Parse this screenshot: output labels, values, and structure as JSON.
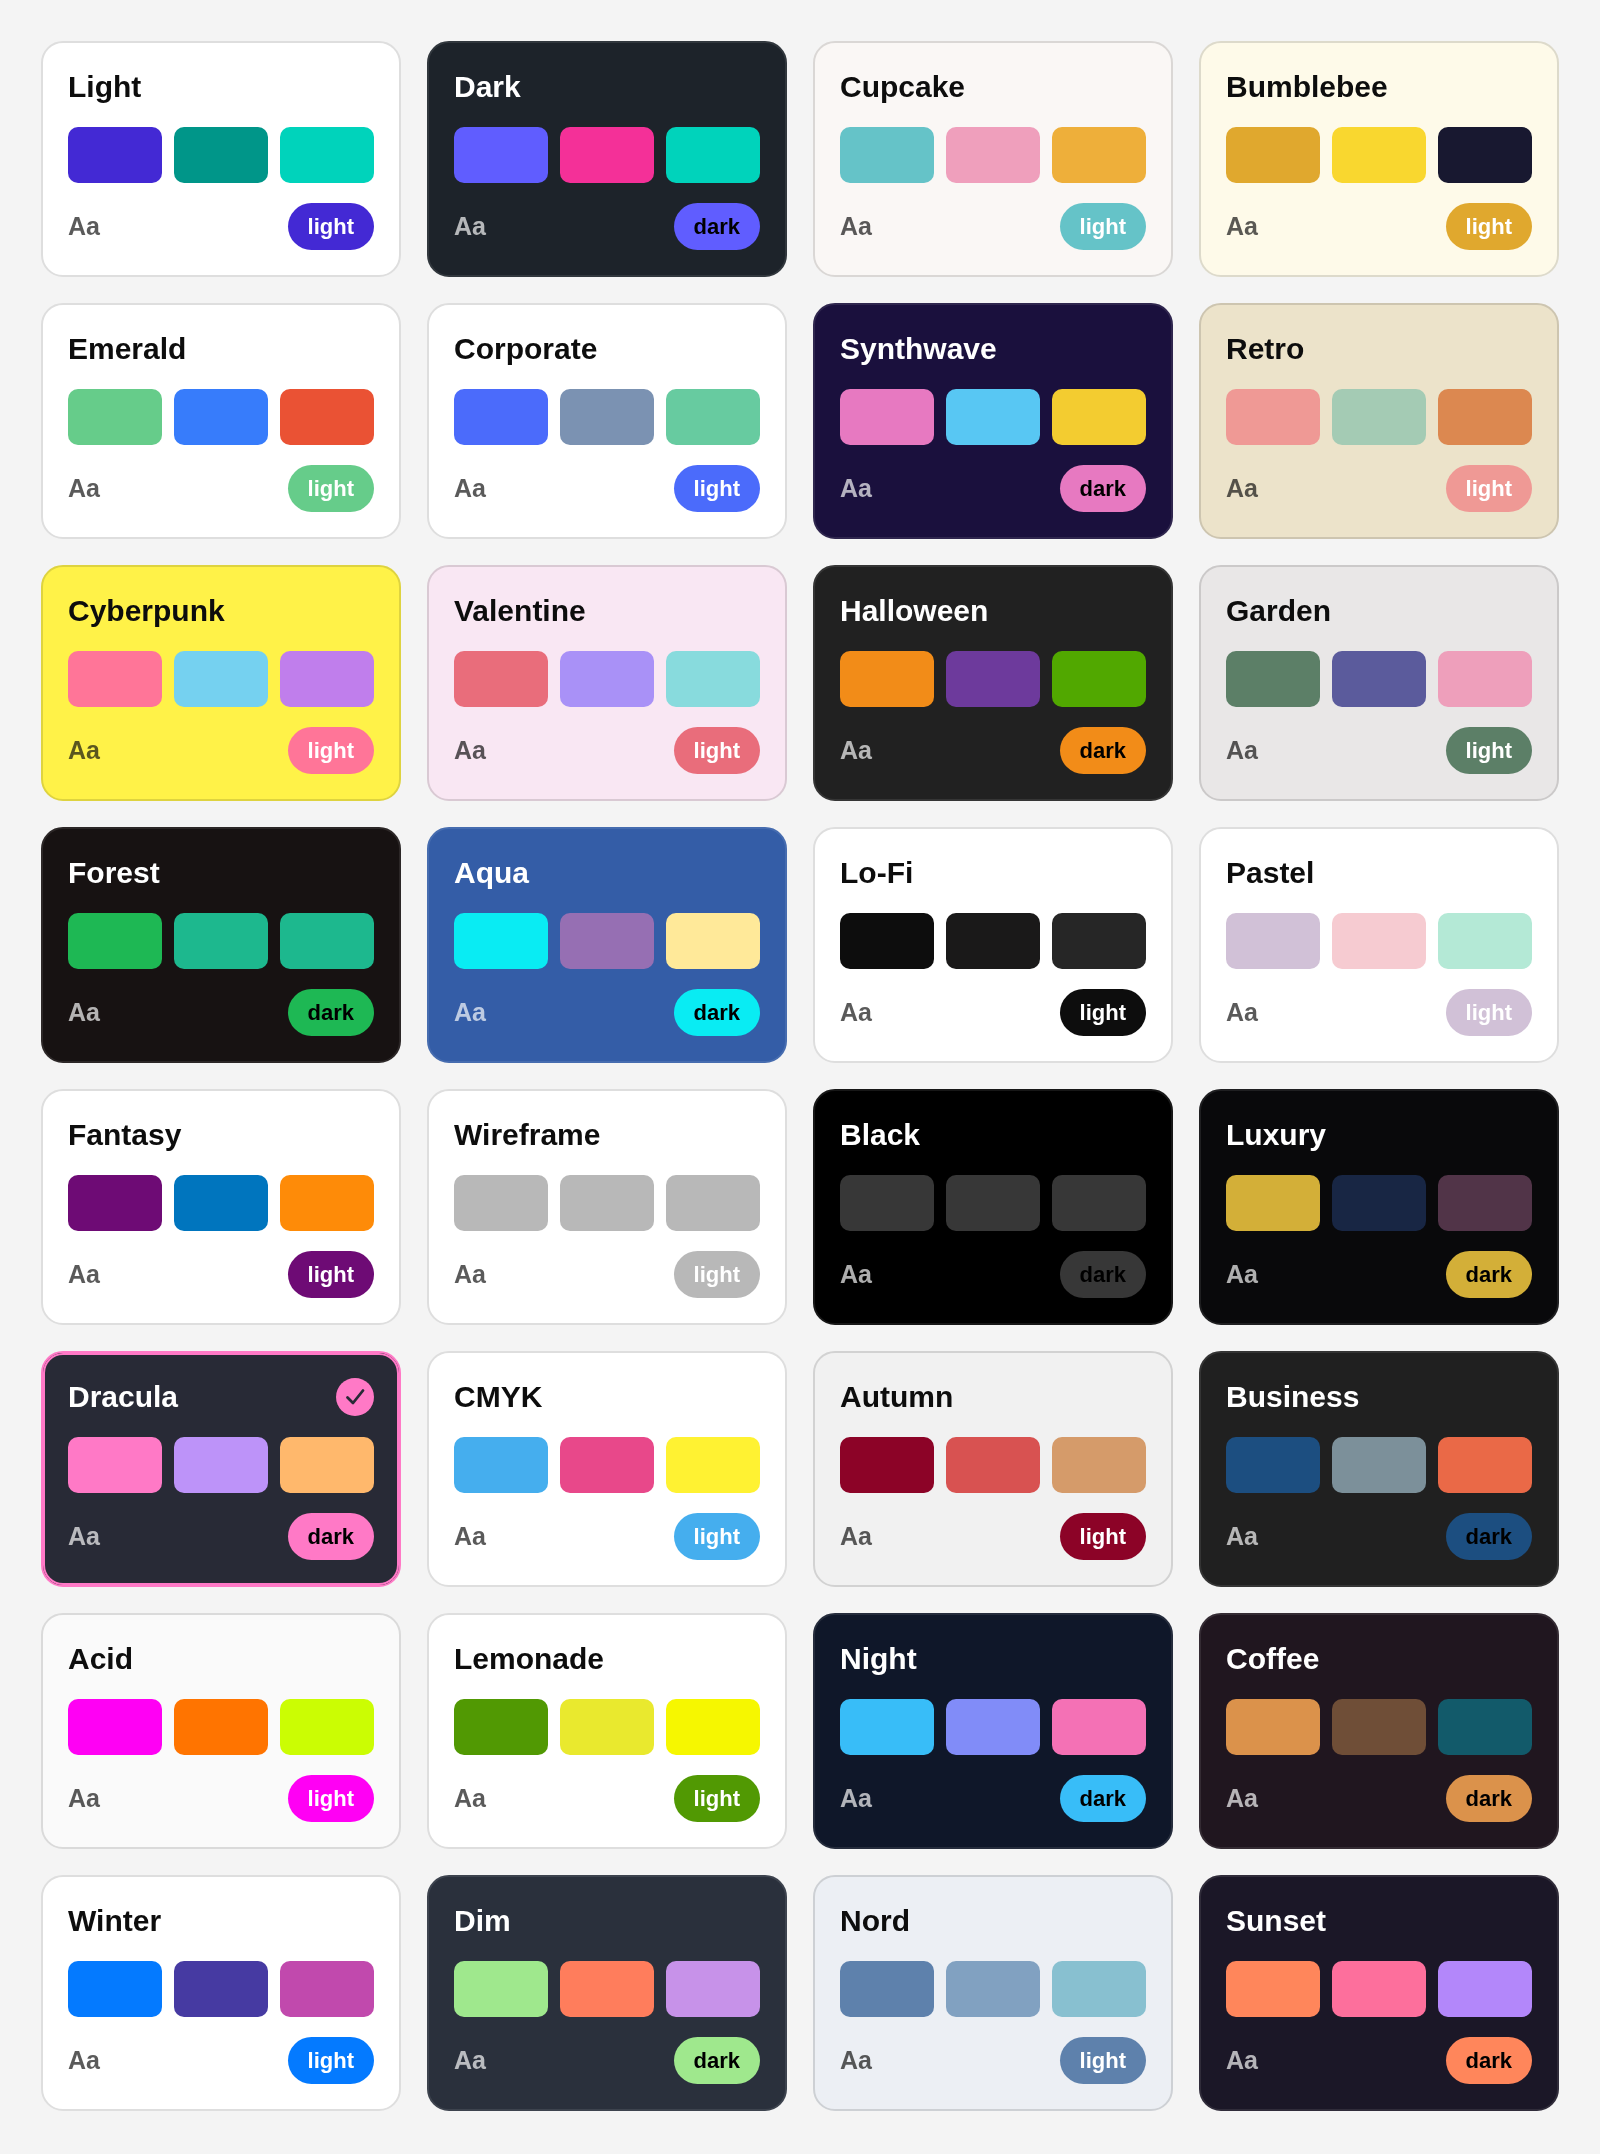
{
  "themes": [
    {
      "name": "Light",
      "kind": "light",
      "color": "#ffffff",
      "selected": false,
      "swatches": [
        {
          "color": "#4329d4"
        },
        {
          "color": "#009689"
        },
        {
          "color": "#00d3bb"
        }
      ],
      "sample": "Aa",
      "mode": "light"
    },
    {
      "name": "Dark",
      "kind": "dark",
      "color": "#1d232a",
      "selected": false,
      "swatches": [
        {
          "color": "#605dff"
        },
        {
          "color": "#f43098"
        },
        {
          "color": "#00d3bb"
        }
      ],
      "sample": "Aa",
      "mode": "dark"
    },
    {
      "name": "Cupcake",
      "kind": "light",
      "color": "#faf7f5",
      "selected": false,
      "swatches": [
        {
          "color": "#65c3c8"
        },
        {
          "color": "#ef9fbc"
        },
        {
          "color": "#eeaf3a"
        }
      ],
      "sample": "Aa",
      "mode": "light"
    },
    {
      "name": "Bumblebee",
      "kind": "light",
      "color": "#fefae9",
      "selected": false,
      "swatches": [
        {
          "color": "#e0a82e"
        },
        {
          "color": "#f9d72f"
        },
        {
          "color": "#181830"
        }
      ],
      "sample": "Aa",
      "mode": "light"
    },
    {
      "name": "Emerald",
      "kind": "light",
      "color": "#ffffff",
      "selected": false,
      "swatches": [
        {
          "color": "#66cc8a"
        },
        {
          "color": "#377cfb"
        },
        {
          "color": "#ea5234"
        }
      ],
      "sample": "Aa",
      "mode": "light"
    },
    {
      "name": "Corporate",
      "kind": "light",
      "color": "#ffffff",
      "selected": false,
      "swatches": [
        {
          "color": "#4b6bfb"
        },
        {
          "color": "#7b92b2"
        },
        {
          "color": "#67cba0"
        }
      ],
      "sample": "Aa",
      "mode": "light"
    },
    {
      "name": "Synthwave",
      "kind": "dark",
      "color": "#1a103d",
      "selected": false,
      "swatches": [
        {
          "color": "#e779c1"
        },
        {
          "color": "#58c7f3"
        },
        {
          "color": "#f3cc30"
        }
      ],
      "sample": "Aa",
      "mode": "dark"
    },
    {
      "name": "Retro",
      "kind": "light",
      "color": "#ece3ca",
      "selected": false,
      "swatches": [
        {
          "color": "#ef9995"
        },
        {
          "color": "#a4cbb4"
        },
        {
          "color": "#dc8850"
        }
      ],
      "sample": "Aa",
      "mode": "light"
    },
    {
      "name": "Cyberpunk",
      "kind": "light",
      "color": "#fff248",
      "selected": false,
      "swatches": [
        {
          "color": "#ff7598"
        },
        {
          "color": "#75d1f0"
        },
        {
          "color": "#c07eec"
        }
      ],
      "sample": "Aa",
      "mode": "light"
    },
    {
      "name": "Valentine",
      "kind": "light",
      "color": "#f9e7f3",
      "selected": false,
      "swatches": [
        {
          "color": "#e96d7b"
        },
        {
          "color": "#a991f7"
        },
        {
          "color": "#88dbdd"
        }
      ],
      "sample": "Aa",
      "mode": "light"
    },
    {
      "name": "Halloween",
      "kind": "dark",
      "color": "#212121",
      "selected": false,
      "swatches": [
        {
          "color": "#f28c18"
        },
        {
          "color": "#6d3a9c"
        },
        {
          "color": "#51a800"
        }
      ],
      "sample": "Aa",
      "mode": "dark"
    },
    {
      "name": "Garden",
      "kind": "light",
      "color": "#e9e7e7",
      "selected": false,
      "swatches": [
        {
          "color": "#5c7f67"
        },
        {
          "color": "#5b5b9c"
        },
        {
          "color": "#ee9fbb"
        }
      ],
      "sample": "Aa",
      "mode": "light"
    },
    {
      "name": "Forest",
      "kind": "dark",
      "color": "#171212",
      "selected": false,
      "swatches": [
        {
          "color": "#1eb854"
        },
        {
          "color": "#1db88e"
        },
        {
          "color": "#1db88e"
        }
      ],
      "sample": "Aa",
      "mode": "dark"
    },
    {
      "name": "Aqua",
      "kind": "dark",
      "color": "#345da7",
      "selected": false,
      "swatches": [
        {
          "color": "#09ecf3"
        },
        {
          "color": "#966fb3"
        },
        {
          "color": "#ffe999"
        }
      ],
      "sample": "Aa",
      "mode": "dark"
    },
    {
      "name": "Lo-Fi",
      "kind": "light",
      "color": "#ffffff",
      "selected": false,
      "swatches": [
        {
          "color": "#0d0d0d"
        },
        {
          "color": "#1a1919"
        },
        {
          "color": "#262626"
        }
      ],
      "sample": "Aa",
      "mode": "light"
    },
    {
      "name": "Pastel",
      "kind": "light",
      "color": "#ffffff",
      "selected": false,
      "swatches": [
        {
          "color": "#d1c1d7"
        },
        {
          "color": "#f6cbd1"
        },
        {
          "color": "#b4e9d6"
        }
      ],
      "sample": "Aa",
      "mode": "light"
    },
    {
      "name": "Fantasy",
      "kind": "light",
      "color": "#ffffff",
      "selected": false,
      "swatches": [
        {
          "color": "#6e0b75"
        },
        {
          "color": "#0075be"
        },
        {
          "color": "#fe8b08"
        }
      ],
      "sample": "Aa",
      "mode": "light"
    },
    {
      "name": "Wireframe",
      "kind": "light",
      "color": "#ffffff",
      "selected": false,
      "swatches": [
        {
          "color": "#b8b8b8"
        },
        {
          "color": "#b8b8b8"
        },
        {
          "color": "#b8b8b8"
        }
      ],
      "sample": "Aa",
      "mode": "light"
    },
    {
      "name": "Black",
      "kind": "dark",
      "color": "#000000",
      "selected": false,
      "swatches": [
        {
          "color": "#373737"
        },
        {
          "color": "#373737"
        },
        {
          "color": "#373737"
        }
      ],
      "sample": "Aa",
      "mode": "dark"
    },
    {
      "name": "Luxury",
      "kind": "dark",
      "color": "#09090b",
      "selected": false,
      "swatches": [
        {
          "color": "#d3af38"
        },
        {
          "color": "#182644"
        },
        {
          "color": "#513448"
        }
      ],
      "sample": "Aa",
      "mode": "dark"
    },
    {
      "name": "Dracula",
      "kind": "dark",
      "color": "#282a36",
      "selected": true,
      "swatches": [
        {
          "color": "#ff79c6"
        },
        {
          "color": "#bd93f9"
        },
        {
          "color": "#ffb86c"
        }
      ],
      "sample": "Aa",
      "mode": "dark"
    },
    {
      "name": "CMYK",
      "kind": "light",
      "color": "#ffffff",
      "selected": false,
      "swatches": [
        {
          "color": "#45aeee"
        },
        {
          "color": "#e8488a"
        },
        {
          "color": "#fff232"
        }
      ],
      "sample": "Aa",
      "mode": "light"
    },
    {
      "name": "Autumn",
      "kind": "light",
      "color": "#f1f1f1",
      "selected": false,
      "swatches": [
        {
          "color": "#8c0327"
        },
        {
          "color": "#d85251"
        },
        {
          "color": "#d59b6a"
        }
      ],
      "sample": "Aa",
      "mode": "light"
    },
    {
      "name": "Business",
      "kind": "dark",
      "color": "#202020",
      "selected": false,
      "swatches": [
        {
          "color": "#1c4e80"
        },
        {
          "color": "#7c909a"
        },
        {
          "color": "#ea6947"
        }
      ],
      "sample": "Aa",
      "mode": "dark"
    },
    {
      "name": "Acid",
      "kind": "light",
      "color": "#fafafa",
      "selected": false,
      "swatches": [
        {
          "color": "#ff00f4"
        },
        {
          "color": "#ff7400"
        },
        {
          "color": "#cbfd03"
        }
      ],
      "sample": "Aa",
      "mode": "light"
    },
    {
      "name": "Lemonade",
      "kind": "light",
      "color": "#ffffff",
      "selected": false,
      "swatches": [
        {
          "color": "#519903"
        },
        {
          "color": "#e9e92e"
        },
        {
          "color": "#f6f700"
        }
      ],
      "sample": "Aa",
      "mode": "light"
    },
    {
      "name": "Night",
      "kind": "dark",
      "color": "#0f1729",
      "selected": false,
      "swatches": [
        {
          "color": "#38bdf8"
        },
        {
          "color": "#818cf8"
        },
        {
          "color": "#f471b5"
        }
      ],
      "sample": "Aa",
      "mode": "dark"
    },
    {
      "name": "Coffee",
      "kind": "dark",
      "color": "#20161f",
      "selected": false,
      "swatches": [
        {
          "color": "#db924b"
        },
        {
          "color": "#6f4e37"
        },
        {
          "color": "#125a6a"
        }
      ],
      "sample": "Aa",
      "mode": "dark"
    },
    {
      "name": "Winter",
      "kind": "light",
      "color": "#ffffff",
      "selected": false,
      "swatches": [
        {
          "color": "#047aff"
        },
        {
          "color": "#463aa2"
        },
        {
          "color": "#c149ad"
        }
      ],
      "sample": "Aa",
      "mode": "light"
    },
    {
      "name": "Dim",
      "kind": "dark",
      "color": "#2a303c",
      "selected": false,
      "swatches": [
        {
          "color": "#9fe88d"
        },
        {
          "color": "#ff7d5c"
        },
        {
          "color": "#c792e9"
        }
      ],
      "sample": "Aa",
      "mode": "dark"
    },
    {
      "name": "Nord",
      "kind": "light",
      "color": "#eceff4",
      "selected": false,
      "swatches": [
        {
          "color": "#5e81ac"
        },
        {
          "color": "#81a1c1"
        },
        {
          "color": "#88c0d0"
        }
      ],
      "sample": "Aa",
      "mode": "light"
    },
    {
      "name": "Sunset",
      "kind": "dark",
      "color": "#1b1727",
      "selected": false,
      "swatches": [
        {
          "color": "#ff865b"
        },
        {
          "color": "#fd6f9c"
        },
        {
          "color": "#b387fa"
        }
      ],
      "sample": "Aa",
      "mode": "dark"
    }
  ]
}
